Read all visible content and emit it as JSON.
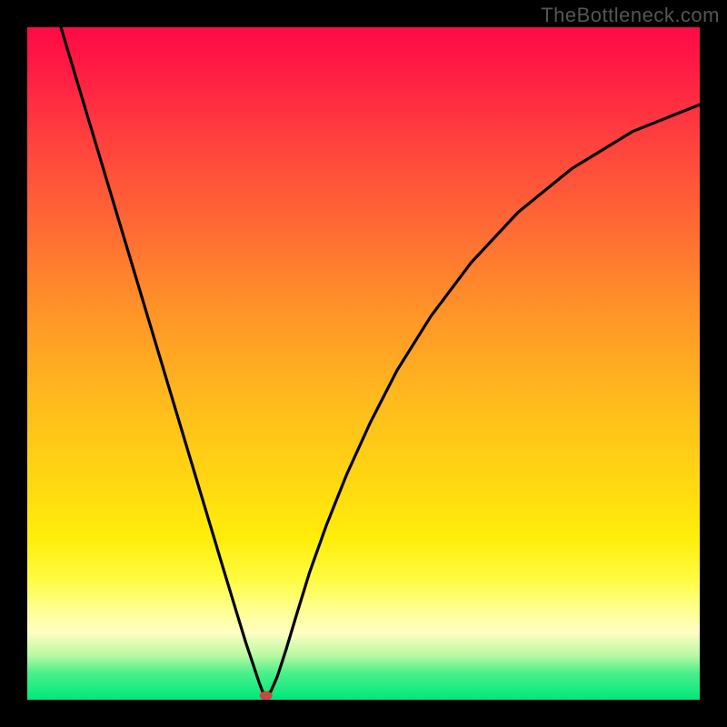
{
  "watermark": "TheBottleneck.com",
  "chart_data": {
    "type": "line",
    "title": "",
    "xlabel": "",
    "ylabel": "",
    "xlim": [
      0,
      1
    ],
    "ylim": [
      0,
      1
    ],
    "x": [
      0.05,
      0.08,
      0.11,
      0.14,
      0.17,
      0.2,
      0.23,
      0.26,
      0.29,
      0.31,
      0.325,
      0.335,
      0.345,
      0.35,
      0.355,
      0.362,
      0.372,
      0.385,
      0.4,
      0.42,
      0.445,
      0.475,
      0.51,
      0.55,
      0.6,
      0.66,
      0.73,
      0.81,
      0.9,
      1.0
    ],
    "values": [
      1.0,
      0.9,
      0.8,
      0.7,
      0.6,
      0.5,
      0.4,
      0.3,
      0.2,
      0.134,
      0.085,
      0.055,
      0.025,
      0.012,
      0.008,
      0.012,
      0.035,
      0.075,
      0.125,
      0.19,
      0.26,
      0.335,
      0.412,
      0.49,
      0.57,
      0.65,
      0.725,
      0.79,
      0.845,
      0.885
    ],
    "marker": {
      "x": 0.355,
      "y": 0.006,
      "color": "#c64a3f"
    },
    "background_gradient": {
      "direction": "vertical",
      "stops": [
        {
          "pos": 0.0,
          "color": "#ff0a46"
        },
        {
          "pos": 0.3,
          "color": "#ff6b34"
        },
        {
          "pos": 0.55,
          "color": "#ffb91e"
        },
        {
          "pos": 0.82,
          "color": "#fffb40"
        },
        {
          "pos": 0.94,
          "color": "#4bf08a"
        },
        {
          "pos": 1.0,
          "color": "#00e77d"
        }
      ]
    },
    "legend": [],
    "grid": false
  }
}
